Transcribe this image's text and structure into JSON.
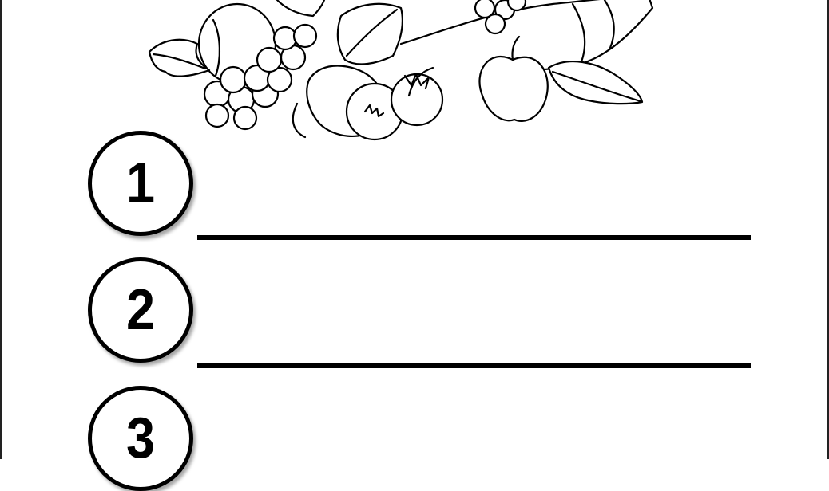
{
  "items": [
    {
      "number": "1"
    },
    {
      "number": "2"
    },
    {
      "number": "3"
    }
  ],
  "illustration": {
    "icon": "cornucopia-fruit-illustration"
  }
}
